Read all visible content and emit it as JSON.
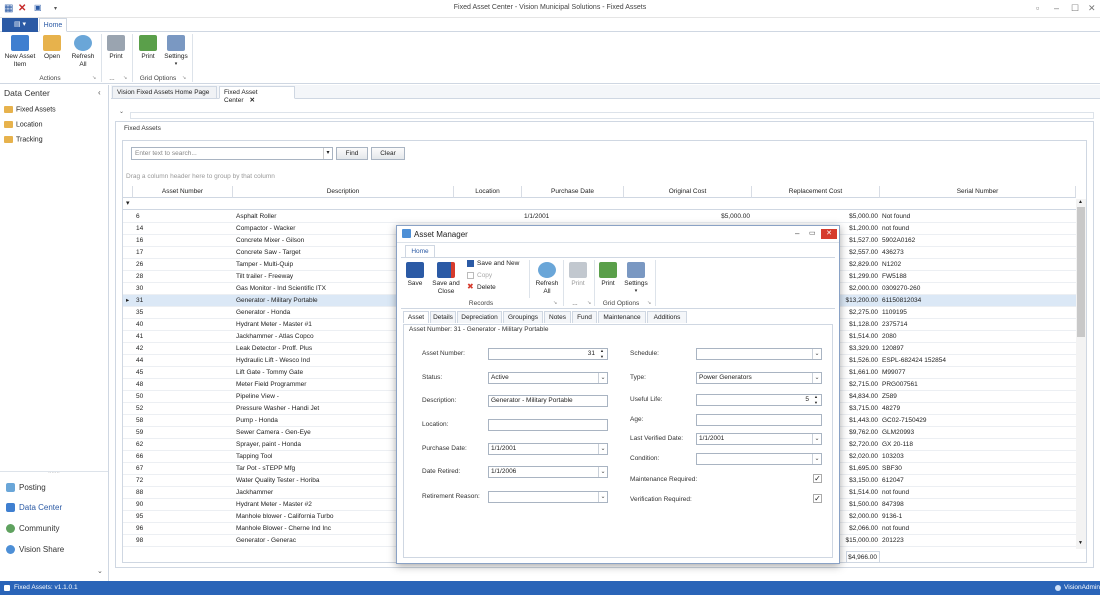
{
  "window": {
    "title": "Fixed Asset Center - Vision Municipal Solutions - Fixed Assets"
  },
  "ribbon": {
    "file_tab": "",
    "home_tab": "Home",
    "buttons": {
      "new_asset": "New Asset\nItem",
      "open": "Open",
      "refresh": "Refresh\nAll",
      "print": "Print",
      "print2": "Print",
      "settings": "Settings"
    },
    "groups": {
      "actions": "Actions",
      "dots": "...",
      "grid_options": "Grid Options"
    }
  },
  "left_pane": {
    "title": "Data Center",
    "tree": [
      "Fixed Assets",
      "Location",
      "Tracking"
    ],
    "nav": [
      "Posting",
      "Data Center",
      "Community",
      "Vision Share"
    ]
  },
  "doc_tabs": [
    "Vision Fixed Assets Home Page",
    "Fixed Asset Center"
  ],
  "panel": {
    "title": "Fixed Assets"
  },
  "search": {
    "placeholder": "Enter text to search...",
    "find": "Find",
    "clear": "Clear"
  },
  "grid": {
    "group_hint": "Drag a column header here to group by that column",
    "columns": [
      "Asset Number",
      "Description",
      "Location",
      "Purchase Date",
      "Original Cost",
      "Replacement Cost",
      "Serial Number"
    ],
    "rows": [
      [
        "6",
        "Asphalt Roller",
        "",
        "1/1/2001",
        "$5,000.00",
        "$5,000.00",
        "Not found"
      ],
      [
        "14",
        "Compactor - Wacker",
        "",
        "",
        "",
        "$1,200.00",
        "not found"
      ],
      [
        "16",
        "Concrete Mixer - Gilson",
        "",
        "",
        "",
        "$1,527.00",
        "5902A0162"
      ],
      [
        "17",
        "Concrete Saw - Target",
        "",
        "",
        "",
        "$2,557.00",
        "436273"
      ],
      [
        "26",
        "Tamper - Multi-Quip",
        "",
        "",
        "",
        "$2,829.00",
        "N1202"
      ],
      [
        "28",
        "Tilt trailer - Freeway",
        "",
        "",
        "",
        "$1,299.00",
        "FW5188"
      ],
      [
        "30",
        "Gas Monitor - Ind Scientific ITX",
        "",
        "",
        "",
        "$2,000.00",
        "0309270-260"
      ],
      [
        "31",
        "Generator - Military Portable",
        "",
        "",
        "",
        "$13,200.00",
        "61150812034"
      ],
      [
        "35",
        "Generator - Honda",
        "",
        "",
        "",
        "$2,275.00",
        "1109195"
      ],
      [
        "40",
        "Hydrant Meter - Master #1",
        "",
        "",
        "",
        "$1,128.00",
        "2375714"
      ],
      [
        "41",
        "Jackhammer - Atlas Copco",
        "",
        "",
        "",
        "$1,514.00",
        "2080"
      ],
      [
        "42",
        "Leak Detector - Proff. Plus",
        "",
        "",
        "",
        "$3,329.00",
        "120897"
      ],
      [
        "44",
        "Hydraulic Lift - Wesco Ind",
        "",
        "",
        "",
        "$1,526.00",
        "ESPL-682424 152854"
      ],
      [
        "45",
        "Lift Gate - Tommy Gate",
        "",
        "",
        "",
        "$1,661.00",
        "M99077"
      ],
      [
        "48",
        "Meter Field Programmer",
        "",
        "",
        "",
        "$2,715.00",
        "PRG007561"
      ],
      [
        "50",
        "Pipeline View -",
        "",
        "",
        "",
        "$4,834.00",
        "Z589"
      ],
      [
        "52",
        "Pressure Washer - Handi Jet",
        "",
        "",
        "",
        "$3,715.00",
        "48279"
      ],
      [
        "58",
        "Pump - Honda",
        "",
        "",
        "",
        "$1,443.00",
        "GC02-7150429"
      ],
      [
        "59",
        "Sewer Camera - Gen-Eye",
        "",
        "",
        "",
        "$9,762.00",
        "GLM20993"
      ],
      [
        "62",
        "Sprayer, paint - Honda",
        "",
        "",
        "",
        "$2,720.00",
        "GX 20-118"
      ],
      [
        "66",
        "Tapping Tool",
        "",
        "",
        "",
        "$2,020.00",
        "103203"
      ],
      [
        "67",
        "Tar Pot - sTEPP Mfg",
        "",
        "",
        "",
        "$1,695.00",
        "SBF30"
      ],
      [
        "72",
        "Water Quality Tester - Horiba",
        "",
        "",
        "",
        "$3,150.00",
        "612047"
      ],
      [
        "88",
        "Jackhammer",
        "",
        "",
        "",
        "$1,514.00",
        "not found"
      ],
      [
        "90",
        "Hydrant Meter - Master #2",
        "",
        "",
        "",
        "$1,500.00",
        "847398"
      ],
      [
        "95",
        "Manhole blower - California Turbo",
        "",
        "",
        "",
        "$2,000.00",
        "9136-1"
      ],
      [
        "96",
        "Manhole Blower - Cherne Ind Inc",
        "",
        "",
        "",
        "$2,066.00",
        "not found"
      ],
      [
        "98",
        "Generator - Generac",
        "",
        "",
        "",
        "$15,000.00",
        "201223"
      ]
    ],
    "total": "$4,966.00"
  },
  "dialog": {
    "title": "Asset Manager",
    "home_tab": "Home",
    "buttons": {
      "save": "Save",
      "save_close": "Save and\nClose",
      "save_new": "Save and New",
      "copy": "Copy",
      "delete": "Delete",
      "refresh": "Refresh\nAll",
      "print": "Print",
      "print2": "Print",
      "settings": "Settings"
    },
    "groups": {
      "records": "Records",
      "dots": "...",
      "grid_options": "Grid Options"
    },
    "tabs": [
      "Asset",
      "Details",
      "Depreciation",
      "Groupings",
      "Notes",
      "Fund",
      "Maintenance",
      "Additions"
    ],
    "header": "Asset Number: 31  -  Generator - Military Portable",
    "left_labels": [
      "Asset Number:",
      "Status:",
      "Description:",
      "Location:",
      "Purchase Date:",
      "Date Retired:",
      "Retirement Reason:"
    ],
    "right_labels": [
      "Schedule:",
      "Type:",
      "Useful Life:",
      "Age:",
      "Last Verified Date:",
      "Condition:",
      "Maintenance Required:",
      "Verification Required:"
    ],
    "values": {
      "asset_number": "31",
      "status": "Active",
      "description": "Generator - Military Portable",
      "location": "",
      "purchase_date": "1/1/2001",
      "date_retired": "1/1/2006",
      "retirement_reason": "",
      "schedule": "",
      "type": "Power Generators",
      "useful_life": "5",
      "age": "",
      "last_verified": "1/1/2001",
      "condition": ""
    },
    "checks": {
      "maintenance": "✓",
      "verification": "✓"
    }
  },
  "status": {
    "left": "Fixed Assets: v1.1.0.1",
    "right": "VisionAdmin"
  }
}
